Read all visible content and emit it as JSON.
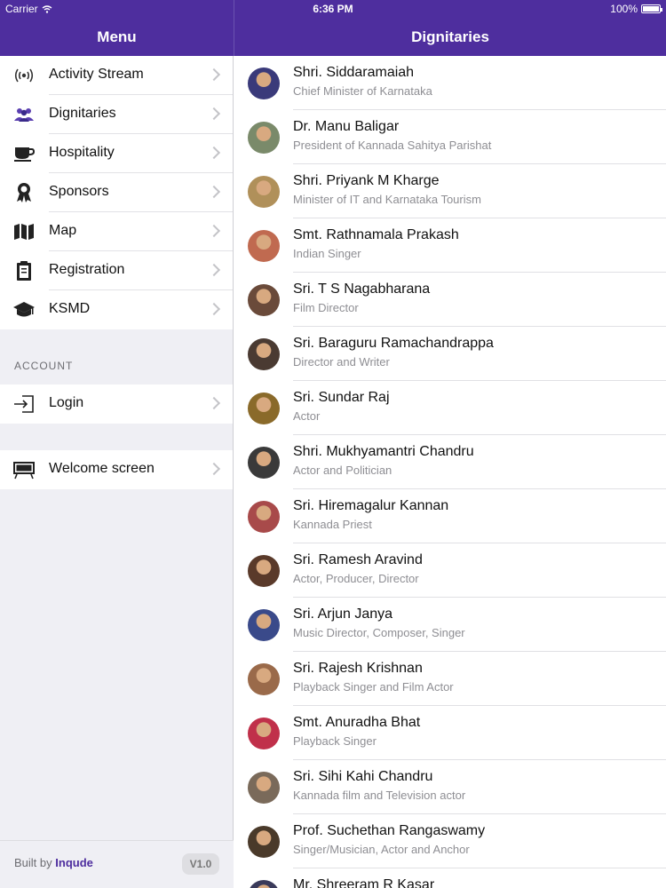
{
  "status": {
    "carrier": "Carrier",
    "time": "6:36 PM",
    "battery": "100%"
  },
  "menu_header": {
    "title": "Menu"
  },
  "list_header": {
    "title": "Dignitaries"
  },
  "menu": {
    "items": [
      {
        "label": "Activity Stream",
        "icon": "broadcast-icon"
      },
      {
        "label": "Dignitaries",
        "icon": "people-icon"
      },
      {
        "label": "Hospitality",
        "icon": "coffee-cup-icon"
      },
      {
        "label": "Sponsors",
        "icon": "award-ribbon-icon"
      },
      {
        "label": "Map",
        "icon": "map-icon"
      },
      {
        "label": "Registration",
        "icon": "clipboard-icon"
      },
      {
        "label": "KSMD",
        "icon": "graduation-cap-icon"
      }
    ],
    "account_label": "ACCOUNT",
    "login_label": "Login",
    "welcome_label": "Welcome screen"
  },
  "footer": {
    "built_by": "Built by",
    "brand": "Inqude",
    "version": "V1.0"
  },
  "colors": {
    "accent": "#4e2e9e",
    "sidebar_bg": "#efeff4"
  },
  "dignitaries": [
    {
      "name": "Shri. Siddaramaiah",
      "title": "Chief Minister of Karnataka",
      "color": "#3a3a7a"
    },
    {
      "name": "Dr. Manu Baligar",
      "title": "President of Kannada Sahitya Parishat",
      "color": "#7a8a6a"
    },
    {
      "name": "Shri. Priyank M Kharge",
      "title": "Minister of IT and Karnataka Tourism",
      "color": "#b0905a"
    },
    {
      "name": "Smt. Rathnamala Prakash",
      "title": "Indian Singer",
      "color": "#c06a50"
    },
    {
      "name": "Sri. T S Nagabharana",
      "title": "Film Director",
      "color": "#6a4a3a"
    },
    {
      "name": "Sri. Baraguru Ramachandrappa",
      "title": "Director and Writer",
      "color": "#4a3a32"
    },
    {
      "name": "Sri. Sundar Raj",
      "title": "Actor",
      "color": "#8a6a2a"
    },
    {
      "name": "Shri. Mukhyamantri Chandru",
      "title": "Actor and Politician",
      "color": "#3a3a3a"
    },
    {
      "name": "Sri. Hiremagalur Kannan",
      "title": "Kannada Priest",
      "color": "#a84a4a"
    },
    {
      "name": "Sri. Ramesh Aravind",
      "title": "Actor, Producer, Director",
      "color": "#5a3a2a"
    },
    {
      "name": "Sri. Arjun Janya",
      "title": "Music Director, Composer, Singer",
      "color": "#3a4a8a"
    },
    {
      "name": "Sri. Rajesh Krishnan",
      "title": "Playback Singer and Film Actor",
      "color": "#9a6a4a"
    },
    {
      "name": "Smt. Anuradha Bhat",
      "title": "Playback Singer",
      "color": "#c0304a"
    },
    {
      "name": "Sri. Sihi Kahi Chandru",
      "title": "Kannada film and Television actor",
      "color": "#7a6a5a"
    },
    {
      "name": "Prof. Suchethan Rangaswamy",
      "title": "Singer/Musician, Actor and Anchor",
      "color": "#4a3a2a"
    },
    {
      "name": "Mr. Shreeram R Kasar",
      "title": "",
      "color": "#3a3a5a"
    }
  ]
}
